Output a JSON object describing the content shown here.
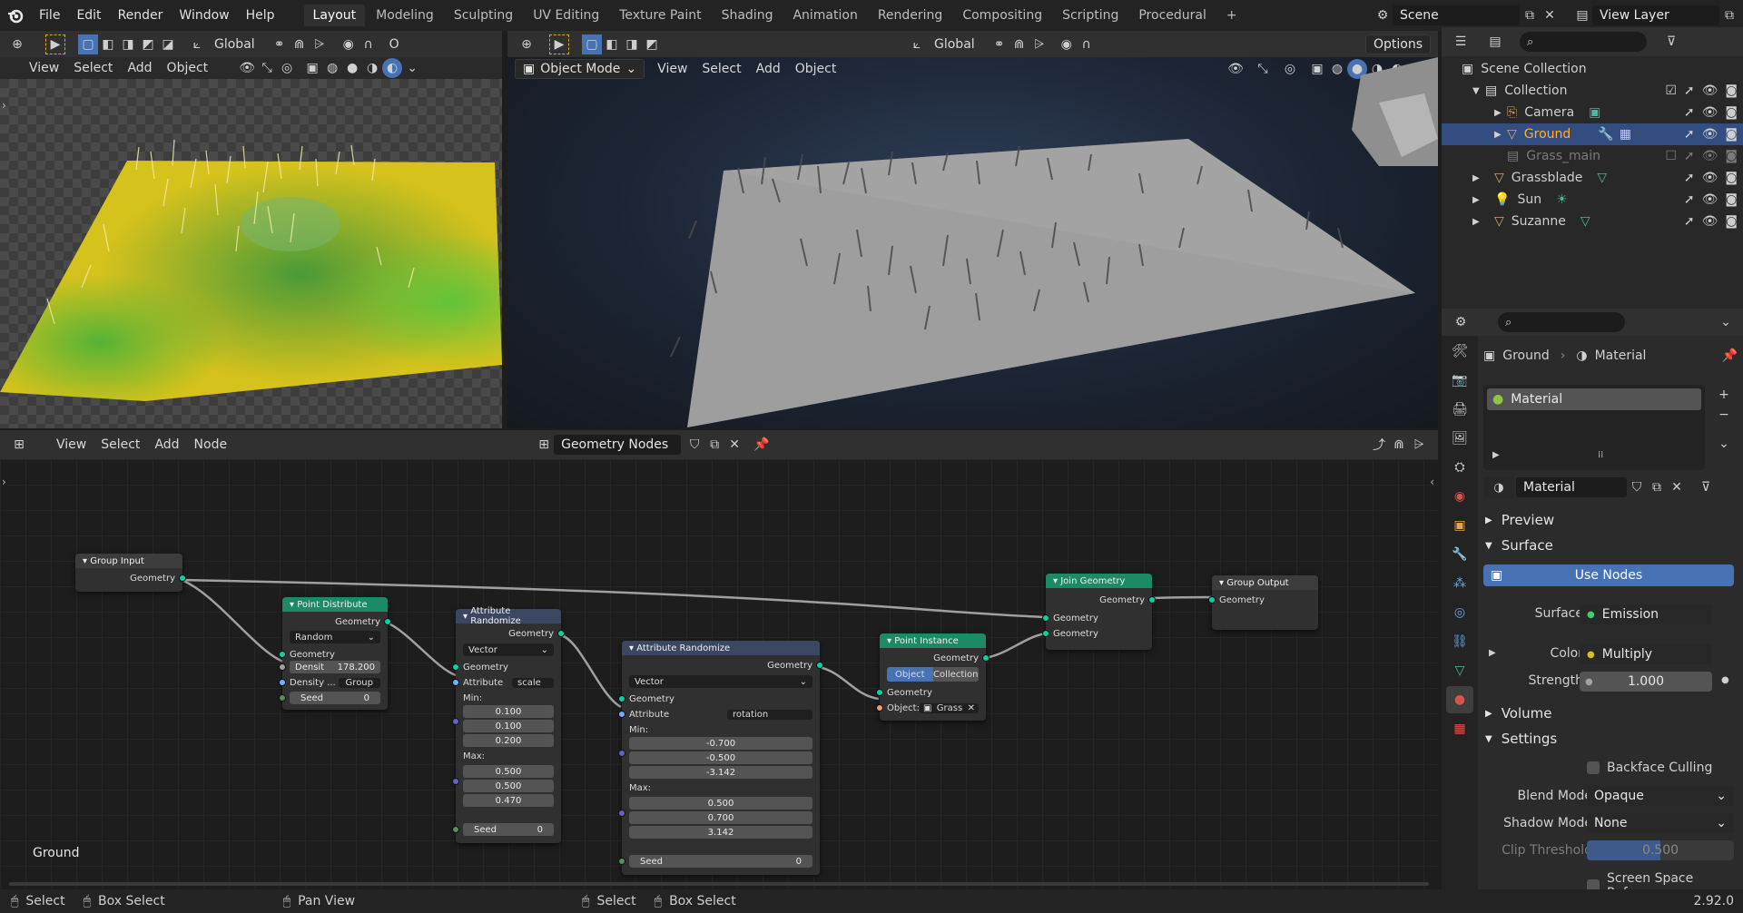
{
  "menubar": {
    "app_icon": "blender-logo-icon",
    "items": [
      "File",
      "Edit",
      "Render",
      "Window",
      "Help"
    ],
    "workspaces": [
      "Layout",
      "Modeling",
      "Sculpting",
      "UV Editing",
      "Texture Paint",
      "Shading",
      "Animation",
      "Rendering",
      "Compositing",
      "Scripting",
      "Procedural"
    ],
    "active_workspace": "Layout",
    "add_workspace": "+",
    "scene": "Scene",
    "view_layer": "View Layer"
  },
  "left_viewport": {
    "orientation": "Global",
    "menus": [
      "View",
      "Select",
      "Add",
      "Object"
    ],
    "frame_label": "O"
  },
  "right_viewport": {
    "orientation": "Global",
    "mode": "Object Mode",
    "menus": [
      "View",
      "Select",
      "Add",
      "Object"
    ],
    "options": "Options"
  },
  "node_editor": {
    "menus": [
      "View",
      "Select",
      "Add",
      "Node"
    ],
    "tree_name": "Geometry Nodes",
    "object_label": "Ground",
    "nodes": {
      "group_input": {
        "title": "Group Input",
        "out": "Geometry"
      },
      "point_distribute": {
        "title": "Point Distribute",
        "out": "Geometry",
        "mode": "Random",
        "in": "Geometry",
        "density_label": "Densit",
        "density_value": "178.200",
        "density_attr_label": "Density ...",
        "density_attr_value": "Group",
        "seed_label": "Seed",
        "seed_value": "0"
      },
      "attr_rand_1": {
        "title": "Attribute Randomize",
        "out": "Geometry",
        "type": "Vector",
        "in": "Geometry",
        "attribute_label": "Attribute",
        "attribute_value": "scale",
        "min_label": "Min:",
        "min": [
          "0.100",
          "0.100",
          "0.200"
        ],
        "max_label": "Max:",
        "max": [
          "0.500",
          "0.500",
          "0.470"
        ],
        "seed_label": "Seed",
        "seed_value": "0"
      },
      "attr_rand_2": {
        "title": "Attribute Randomize",
        "out": "Geometry",
        "type": "Vector",
        "in": "Geometry",
        "attribute_label": "Attribute",
        "attribute_value": "rotation",
        "min_label": "Min:",
        "min": [
          "-0.700",
          "-0.500",
          "-3.142"
        ],
        "max_label": "Max:",
        "max": [
          "0.500",
          "0.700",
          "3.142"
        ],
        "seed_label": "Seed",
        "seed_value": "0"
      },
      "point_instance": {
        "title": "Point Instance",
        "out": "Geometry",
        "tab_object": "Object",
        "tab_collection": "Collection",
        "in": "Geometry",
        "object_label": "Object:",
        "object_value": "Grass"
      },
      "join_geometry": {
        "title": "Join Geometry",
        "out": "Geometry",
        "in1": "Geometry",
        "in2": "Geometry"
      },
      "group_output": {
        "title": "Group Output",
        "in": "Geometry"
      }
    }
  },
  "outliner": {
    "scene_collection": "Scene Collection",
    "items": [
      {
        "name": "Collection",
        "icon": "collection-icon"
      },
      {
        "name": "Camera",
        "icon": "camera-icon"
      },
      {
        "name": "Ground",
        "icon": "mesh-icon",
        "selected": true
      },
      {
        "name": "Grass_main",
        "icon": "mesh-icon",
        "disabled": true
      },
      {
        "name": "Grassblade",
        "icon": "mesh-icon"
      },
      {
        "name": "Sun",
        "icon": "light-icon"
      },
      {
        "name": "Suzanne",
        "icon": "mesh-icon"
      }
    ]
  },
  "properties": {
    "breadcrumb_object": "Ground",
    "breadcrumb_material": "Material",
    "slot": "Material",
    "material_name": "Material",
    "panels": {
      "preview": "Preview",
      "surface": "Surface",
      "volume": "Volume",
      "settings": "Settings"
    },
    "use_nodes": "Use Nodes",
    "surface_label": "Surface",
    "surface_value": "Emission",
    "color_label": "Color",
    "color_value": "Multiply",
    "strength_label": "Strength",
    "strength_value": "1.000",
    "backface_culling": "Backface Culling",
    "blend_mode_label": "Blend Mode",
    "blend_mode_value": "Opaque",
    "shadow_mode_label": "Shadow Mode",
    "shadow_mode_value": "None",
    "clip_threshold_label": "Clip Threshold",
    "clip_threshold_value": "0.500",
    "clip_threshold_fraction": 0.5,
    "screen_space_refraction": "Screen Space Refra..."
  },
  "statusbar": {
    "items": [
      "Select",
      "Box Select",
      "Pan View",
      "Select",
      "Box Select"
    ],
    "version": "2.92.0"
  },
  "colors": {
    "accent_blue": "#4772b3",
    "geometry_socket": "#00d6a3",
    "node_green_header": "#1b8a67",
    "node_blue_header": "#3b4661",
    "selected_orange": "#ffaf29"
  }
}
